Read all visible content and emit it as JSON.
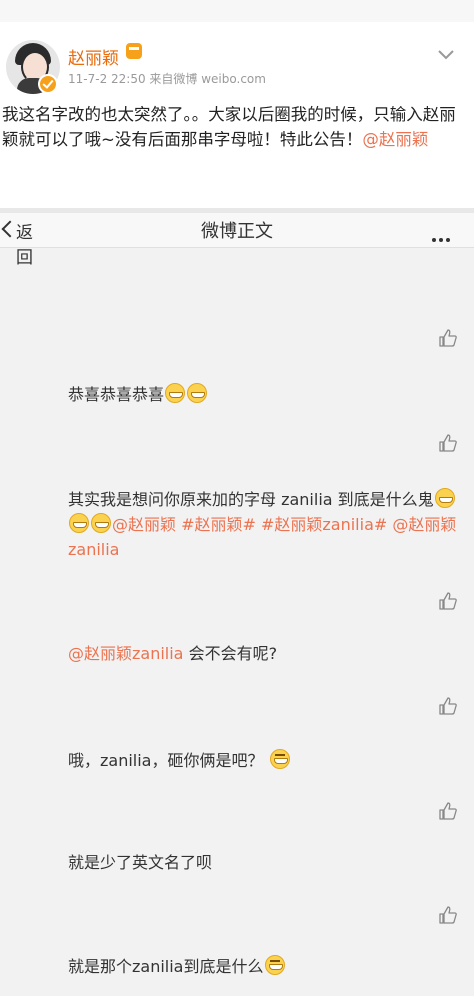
{
  "post": {
    "user_name": "赵丽颖",
    "meta": "11-7-2 22:50  来自微博 weibo.com",
    "text": "我这名字改的也太突然了。。大家以后圈我的时候，只输入赵丽颖就可以了哦~没有后面那串字母啦！特此公告！",
    "mention": "@赵丽颖"
  },
  "navbar": {
    "back_label": "返回",
    "title": "微博正文"
  },
  "comments": [
    {
      "text": "恭喜恭喜恭喜"
    },
    {
      "text_a": "其实我是想问你原来加的字母 zanilia 到底是什么鬼",
      "links": "@赵丽颖 #赵丽颖# #赵丽颖zanilia# @赵丽颖zanilia"
    },
    {
      "link": "@赵丽颖zanilia",
      "text": " 会不会有呢?"
    },
    {
      "text": "哦，zanilia，砸你俩是吧？"
    },
    {
      "text": "就是少了英文名了呗"
    },
    {
      "text": "就是那个zanilia到底是什么"
    }
  ],
  "colors": {
    "name": "#e86b0c",
    "link": "#eb7350",
    "background": "#f2f2f2"
  },
  "icons": [
    "verified-badge-icon",
    "follow-chevron-icon",
    "back-chevron-icon",
    "more-icon",
    "like-icon",
    "grin-emoji-icon",
    "laugh-emoji-icon"
  ]
}
